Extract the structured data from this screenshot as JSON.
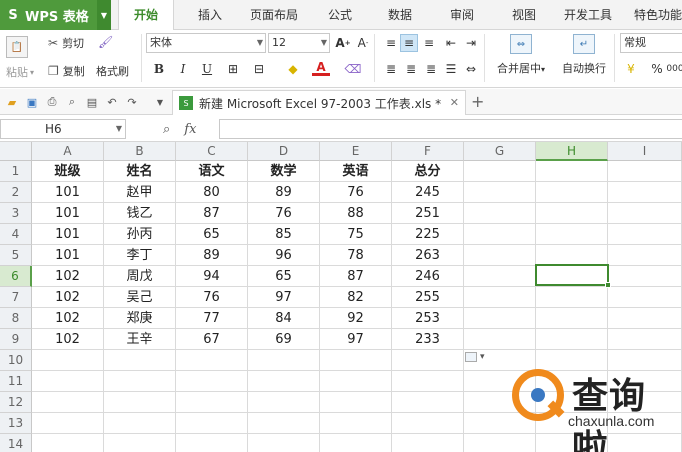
{
  "app": {
    "name": "WPS 表格",
    "logo": "S"
  },
  "menu": {
    "tabs": [
      "开始",
      "插入",
      "页面布局",
      "公式",
      "数据",
      "审阅",
      "视图",
      "开发工具",
      "特色功能"
    ],
    "active": "开始"
  },
  "ribbon": {
    "cut": "剪切",
    "paste": "粘贴",
    "copy": "复制",
    "format_painter": "格式刷",
    "font_name": "宋体",
    "font_size": "12",
    "bold": "B",
    "italic": "I",
    "underline": "U",
    "font_color_glyph": "A",
    "merge_center": "合并居中",
    "wrap_text": "自动换行",
    "number_format": "常规",
    "percent": "%",
    "thousands": "000"
  },
  "doc_tab": {
    "title": "新建 Microsoft Excel 97-2003 工作表.xls *",
    "icon": "xls-icon"
  },
  "formula_bar": {
    "name_box": "H6",
    "fx": "fx",
    "value": ""
  },
  "grid": {
    "columns": [
      "A",
      "B",
      "C",
      "D",
      "E",
      "F",
      "G",
      "H",
      "I"
    ],
    "rows": [
      "1",
      "2",
      "3",
      "4",
      "5",
      "6",
      "7",
      "8",
      "9",
      "10",
      "11",
      "12",
      "13",
      "14"
    ],
    "selected_column": "H",
    "selected_row": "6",
    "cells": [
      [
        "班级",
        "姓名",
        "语文",
        "数学",
        "英语",
        "总分"
      ],
      [
        "101",
        "赵甲",
        "80",
        "89",
        "76",
        "245"
      ],
      [
        "101",
        "钱乙",
        "87",
        "76",
        "88",
        "251"
      ],
      [
        "101",
        "孙丙",
        "65",
        "85",
        "75",
        "225"
      ],
      [
        "101",
        "李丁",
        "89",
        "96",
        "78",
        "263"
      ],
      [
        "102",
        "周戊",
        "94",
        "65",
        "87",
        "246"
      ],
      [
        "102",
        "吴己",
        "76",
        "97",
        "82",
        "255"
      ],
      [
        "102",
        "郑庚",
        "77",
        "84",
        "92",
        "253"
      ],
      [
        "102",
        "王辛",
        "67",
        "69",
        "97",
        "233"
      ]
    ]
  },
  "watermark": {
    "cn": "查询啦",
    "en": "chaxunla.com"
  }
}
